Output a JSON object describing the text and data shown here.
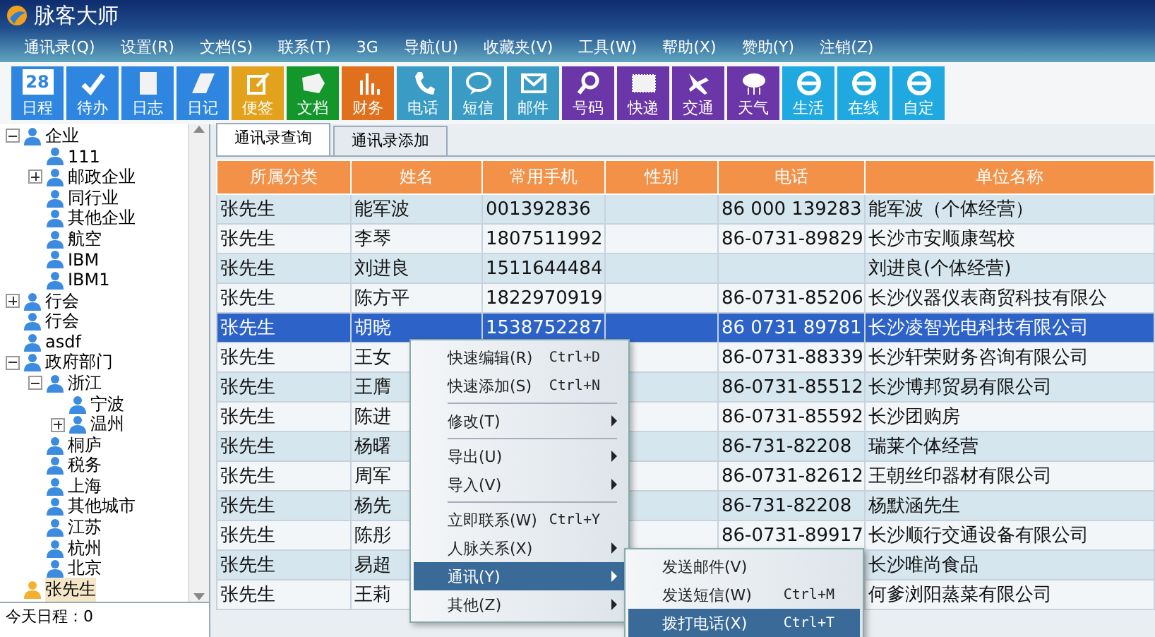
{
  "window": {
    "title": "脉客大师"
  },
  "menubar": [
    "通讯录(Q)",
    "设置(R)",
    "文档(S)",
    "联系(T)",
    "3G",
    "导航(U)",
    "收藏夹(V)",
    "工具(W)",
    "帮助(X)",
    "赞助(Y)",
    "注销(Z)"
  ],
  "toolbar": [
    {
      "label": "日程",
      "color": "#2f86e0",
      "badge": "28"
    },
    {
      "label": "待办",
      "color": "#2f86e0"
    },
    {
      "label": "日志",
      "color": "#2f86e0"
    },
    {
      "label": "日记",
      "color": "#2f86e0"
    },
    {
      "label": "便签",
      "color": "#e3a21c"
    },
    {
      "label": "文档",
      "color": "#13962a"
    },
    {
      "label": "财务",
      "color": "#e0701c"
    },
    {
      "label": "电话",
      "color": "#3a9cc4"
    },
    {
      "label": "短信",
      "color": "#3a9cc4"
    },
    {
      "label": "邮件",
      "color": "#3a9cc4"
    },
    {
      "label": "号码",
      "color": "#6a36a8"
    },
    {
      "label": "快递",
      "color": "#6a36a8"
    },
    {
      "label": "交通",
      "color": "#6a36a8"
    },
    {
      "label": "天气",
      "color": "#6a36a8"
    },
    {
      "label": "生活",
      "color": "#1fa9e0"
    },
    {
      "label": "在线",
      "color": "#1fa9e0"
    },
    {
      "label": "自定",
      "color": "#1fa9e0"
    }
  ],
  "tree": [
    {
      "label": "企业",
      "expanded": true,
      "selected": false,
      "children": [
        {
          "label": "111",
          "selected": false
        },
        {
          "label": "邮政企业",
          "expanded": false,
          "selected": false
        },
        {
          "label": "同行业",
          "selected": false
        },
        {
          "label": "其他企业",
          "selected": false
        },
        {
          "label": "航空",
          "selected": false
        },
        {
          "label": "IBM",
          "selected": false
        },
        {
          "label": "IBM1",
          "selected": false
        }
      ]
    },
    {
      "label": "行会",
      "expanded": false,
      "selected": false
    },
    {
      "label": "行会",
      "selected": false
    },
    {
      "label": "asdf",
      "selected": false
    },
    {
      "label": "政府部门",
      "expanded": true,
      "selected": false,
      "children": [
        {
          "label": "浙江",
          "expanded": true,
          "selected": false,
          "children": [
            {
              "label": "宁波",
              "selected": false
            },
            {
              "label": "温州",
              "expanded": false,
              "selected": false
            }
          ]
        },
        {
          "label": "桐庐",
          "selected": false
        },
        {
          "label": "税务",
          "selected": false
        },
        {
          "label": "上海",
          "selected": false
        },
        {
          "label": "其他城市",
          "selected": false
        },
        {
          "label": "江苏",
          "selected": false
        },
        {
          "label": "杭州",
          "selected": false
        },
        {
          "label": "北京",
          "selected": false
        }
      ]
    },
    {
      "label": "张先生",
      "selected": true
    }
  ],
  "status_bar": "今天日程：0",
  "tabs": [
    {
      "label": "通讯录查询",
      "selected": true
    },
    {
      "label": "通讯录添加",
      "selected": false
    }
  ],
  "table": {
    "columns": [
      "所属分类",
      "姓名",
      "常用手机",
      "性别",
      "电话",
      "单位名称"
    ],
    "rows": [
      {
        "selected": false,
        "cells": [
          "张先生",
          "能军波",
          "001392836",
          "",
          "86 000 139283",
          "能军波（个体经营）"
        ]
      },
      {
        "selected": false,
        "cells": [
          "张先生",
          "李琴",
          "1807511992",
          "",
          "86-0731-89829",
          "长沙市安顺康驾校"
        ]
      },
      {
        "selected": false,
        "cells": [
          "张先生",
          "刘进良",
          "1511644484",
          "",
          "",
          "刘进良(个体经营)"
        ]
      },
      {
        "selected": false,
        "cells": [
          "张先生",
          "陈方平",
          "1822970919",
          "",
          "86-0731-85206",
          "长沙仪器仪表商贸科技有限公"
        ]
      },
      {
        "selected": true,
        "cells": [
          "张先生",
          "胡晓",
          "1538752287",
          "",
          "86 0731 89781",
          "长沙凌智光电科技有限公司"
        ]
      },
      {
        "selected": false,
        "cells": [
          "张先生",
          "王女",
          "",
          "",
          "86-0731-88339",
          "长沙轩荣财务咨询有限公司"
        ]
      },
      {
        "selected": false,
        "cells": [
          "张先生",
          "王膺",
          "",
          "",
          "86-0731-85512",
          "长沙博邦贸易有限公司"
        ]
      },
      {
        "selected": false,
        "cells": [
          "张先生",
          "陈进",
          "",
          "",
          "86-0731-85592",
          "长沙团购房"
        ]
      },
      {
        "selected": false,
        "cells": [
          "张先生",
          "杨曙",
          "",
          "",
          "86-731-82208",
          "瑞莱个体经营"
        ]
      },
      {
        "selected": false,
        "cells": [
          "张先生",
          "周军",
          "",
          "",
          "86-0731-82612",
          "王朝丝印器材有限公司"
        ]
      },
      {
        "selected": false,
        "cells": [
          "张先生",
          "杨先",
          "",
          "",
          "86-731-82208",
          "杨默涵先生"
        ]
      },
      {
        "selected": false,
        "cells": [
          "张先生",
          "陈彤",
          "",
          "",
          "86-0731-89917",
          "长沙顺行交通设备有限公司"
        ]
      },
      {
        "selected": false,
        "cells": [
          "张先生",
          "易超",
          "",
          "",
          "",
          "长沙唯尚食品"
        ]
      },
      {
        "selected": false,
        "cells": [
          "张先生",
          "王莉",
          "",
          "",
          "",
          "何爹浏阳蒸菜有限公司"
        ]
      }
    ]
  },
  "context_menu": [
    {
      "kind": "item",
      "label": "快速编辑(R)",
      "shortcut": "Ctrl+D",
      "submenu": false,
      "selected": false
    },
    {
      "kind": "item",
      "label": "快速添加(S)",
      "shortcut": "Ctrl+N",
      "submenu": false,
      "selected": false
    },
    {
      "kind": "separator"
    },
    {
      "kind": "item",
      "label": "修改(T)",
      "submenu": true,
      "selected": false
    },
    {
      "kind": "separator"
    },
    {
      "kind": "item",
      "label": "导出(U)",
      "submenu": true,
      "selected": false
    },
    {
      "kind": "item",
      "label": "导入(V)",
      "submenu": true,
      "selected": false
    },
    {
      "kind": "separator"
    },
    {
      "kind": "item",
      "label": "立即联系(W)",
      "shortcut": "Ctrl+Y",
      "submenu": false,
      "selected": false
    },
    {
      "kind": "item",
      "label": "人脉关系(X)",
      "submenu": true,
      "selected": false
    },
    {
      "kind": "item",
      "label": "通讯(Y)",
      "submenu": true,
      "selected": true
    },
    {
      "kind": "item",
      "label": "其他(Z)",
      "submenu": true,
      "selected": false
    }
  ],
  "submenu": [
    {
      "kind": "item",
      "label": "发送邮件(V)",
      "selected": false
    },
    {
      "kind": "item",
      "label": "发送短信(W)",
      "shortcut": "Ctrl+M",
      "selected": false
    },
    {
      "kind": "item",
      "label": "拨打电话(X)",
      "shortcut": "Ctrl+T",
      "selected": true
    }
  ]
}
